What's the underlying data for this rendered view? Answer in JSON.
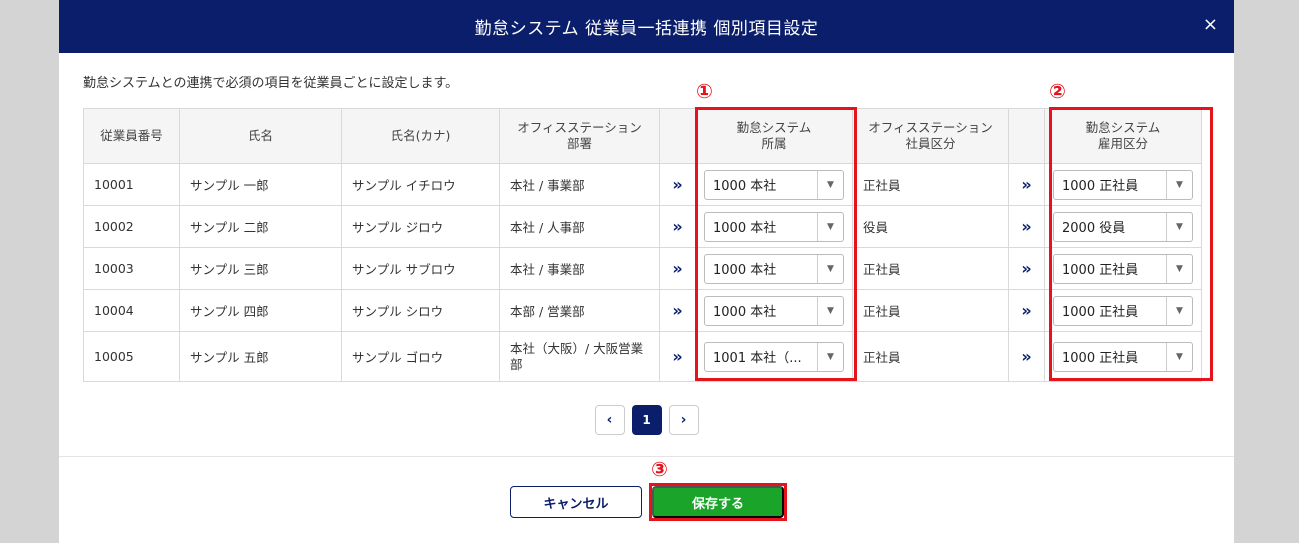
{
  "dialog": {
    "title": "勤怠システム 従業員一括連携 個別項目設定",
    "close_icon": "×"
  },
  "description": "勤怠システムとの連携で必須の項目を従業員ごとに設定します。",
  "markers": [
    "①",
    "②",
    "③"
  ],
  "table": {
    "headers": {
      "emp_no": "従業員番号",
      "name": "氏名",
      "kana": "氏名(カナ)",
      "os_dept": [
        "オフィスステーション",
        "部署"
      ],
      "att_dept": [
        "勤怠システム",
        "所属"
      ],
      "os_class": [
        "オフィスステーション",
        "社員区分"
      ],
      "att_class": [
        "勤怠システム",
        "雇用区分"
      ]
    },
    "arrow_glyph": "»",
    "rows": [
      {
        "emp_no": "10001",
        "name": "サンプル 一郎",
        "kana": "サンプル イチロウ",
        "dept": "本社 / 事業部",
        "att_dept": "1000 本社",
        "os_class": "正社員",
        "att_class": "1000 正社員"
      },
      {
        "emp_no": "10002",
        "name": "サンプル 二郎",
        "kana": "サンプル ジロウ",
        "dept": "本社 / 人事部",
        "att_dept": "1000 本社",
        "os_class": "役員",
        "att_class": "2000 役員"
      },
      {
        "emp_no": "10003",
        "name": "サンプル 三郎",
        "kana": "サンプル サブロウ",
        "dept": "本社 / 事業部",
        "att_dept": "1000 本社",
        "os_class": "正社員",
        "att_class": "1000 正社員"
      },
      {
        "emp_no": "10004",
        "name": "サンプル 四郎",
        "kana": "サンプル シロウ",
        "dept": "本部 / 営業部",
        "att_dept": "1000 本社",
        "os_class": "正社員",
        "att_class": "1000 正社員"
      },
      {
        "emp_no": "10005",
        "name": "サンプル 五郎",
        "kana": "サンプル ゴロウ",
        "dept": "本社（大阪）/ 大阪営業部",
        "att_dept": "1001 本社（...",
        "os_class": "正社員",
        "att_class": "1000 正社員"
      }
    ]
  },
  "pagination": {
    "prev": "‹",
    "current": "1",
    "next": "›"
  },
  "footer": {
    "cancel_label": "キャンセル",
    "save_label": "保存する"
  },
  "colors": {
    "header": "#0b1e6b",
    "save": "#1aa52a",
    "highlight": "#e5141c"
  }
}
